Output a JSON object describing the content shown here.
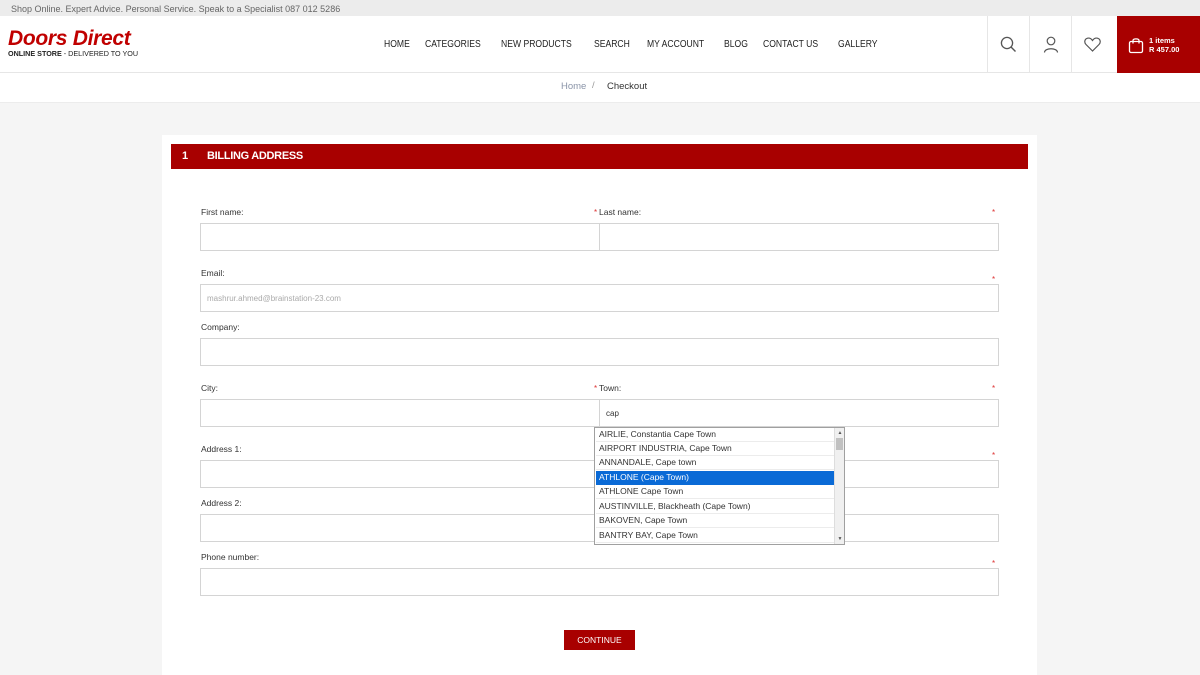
{
  "topbar": {
    "text": "Shop Online. Expert Advice. Personal Service. Speak to a Specialist 087 012 5286"
  },
  "logo": {
    "main": "Doors Direct",
    "sub_bold": "ONLINE STORE",
    "sub_rest": " - DELIVERED TO YOU"
  },
  "nav": [
    "HOME",
    "CATEGORIES",
    "NEW PRODUCTS",
    "SEARCH",
    "MY ACCOUNT",
    "BLOG",
    "CONTACT US",
    "GALLERY"
  ],
  "header_icons": [
    "search-icon",
    "user-icon",
    "heart-icon"
  ],
  "cart": {
    "items": "1 items",
    "total": "R 457.00",
    "icon": "shopping-bag-icon"
  },
  "breadcrumb": {
    "home": "Home",
    "separator": "/",
    "current": "Checkout"
  },
  "section": {
    "number": "1",
    "title": "BILLING ADDRESS"
  },
  "form": {
    "first_name": {
      "label": "First name:",
      "value": ""
    },
    "last_name": {
      "label": "Last name:",
      "value": ""
    },
    "email": {
      "label": "Email:",
      "value": "",
      "placeholder": "mashrur.ahmed@brainstation-23.com"
    },
    "company": {
      "label": "Company:",
      "value": ""
    },
    "city": {
      "label": "City:",
      "value": ""
    },
    "town": {
      "label": "Town:",
      "value": "cap"
    },
    "address1": {
      "label": "Address 1:",
      "value": ""
    },
    "address2": {
      "label": "Address 2:",
      "value": ""
    },
    "phone": {
      "label": "Phone number:",
      "value": ""
    },
    "required_mark": "*"
  },
  "autocomplete": {
    "items": [
      "AIRLIE, Constantia Cape Town",
      "AIRPORT INDUSTRIA, Cape Town",
      "ANNANDALE, Cape town",
      "ATHLONE (Cape Town)",
      "ATHLONE Cape Town",
      "AUSTINVILLE, Blackheath (Cape Town)",
      "BAKOVEN, Cape Town",
      "BANTRY BAY, Cape Town"
    ],
    "selected": "ATHLONE (Cape Town)"
  },
  "continue_label": "CONTINUE",
  "colors": {
    "brand_red": "#a80000",
    "selection_blue": "#0a6ad6"
  }
}
